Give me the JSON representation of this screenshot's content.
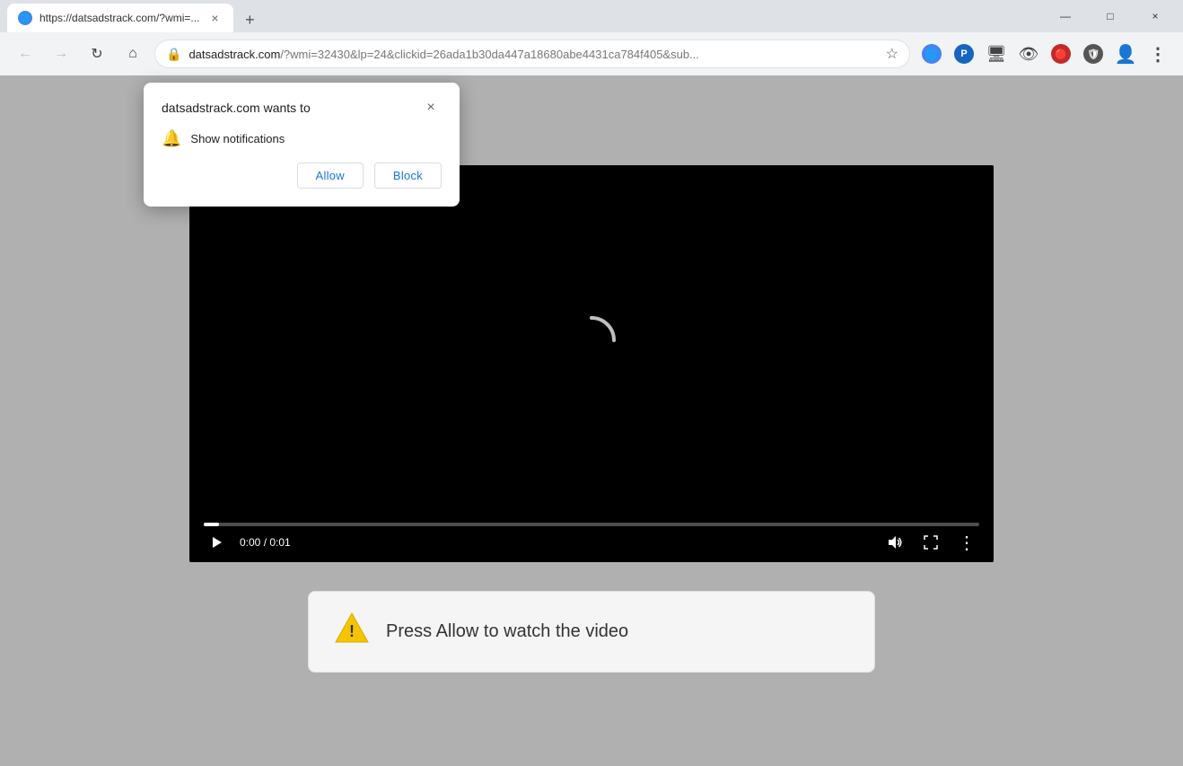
{
  "titleBar": {
    "tab": {
      "favicon": "🌐",
      "title": "https://datsadstrack.com/?wmi=...",
      "closeLabel": "×"
    },
    "newTabLabel": "+",
    "windowControls": {
      "minimize": "—",
      "maximize": "□",
      "close": "×"
    }
  },
  "omnibar": {
    "back": "←",
    "forward": "→",
    "reload": "↻",
    "home": "⌂",
    "url": {
      "domain": "datsadstrack.com",
      "path": "/?wmi=32430&lp=24&clickid=26ada1b30da447a18680abe4431ca784f405&sub..."
    },
    "starLabel": "☆",
    "extensions": {
      "ext1": "🔵",
      "ext2": "📄",
      "ext3": "🖼",
      "ext4": "👁",
      "ext5": "🔴",
      "ext6": "🛡",
      "profileIcon": "👤",
      "menuDots": "⋮"
    }
  },
  "notificationPopup": {
    "title": "datsadstrack.com wants to",
    "closeLabel": "×",
    "notificationText": "Show notifications",
    "allowLabel": "Allow",
    "blockLabel": "Block"
  },
  "videoPlayer": {
    "timeDisplay": "0:00 / 0:01",
    "progressPercent": 2
  },
  "warningBox": {
    "iconUnicode": "⚠",
    "text": "Press Allow to watch the video"
  }
}
